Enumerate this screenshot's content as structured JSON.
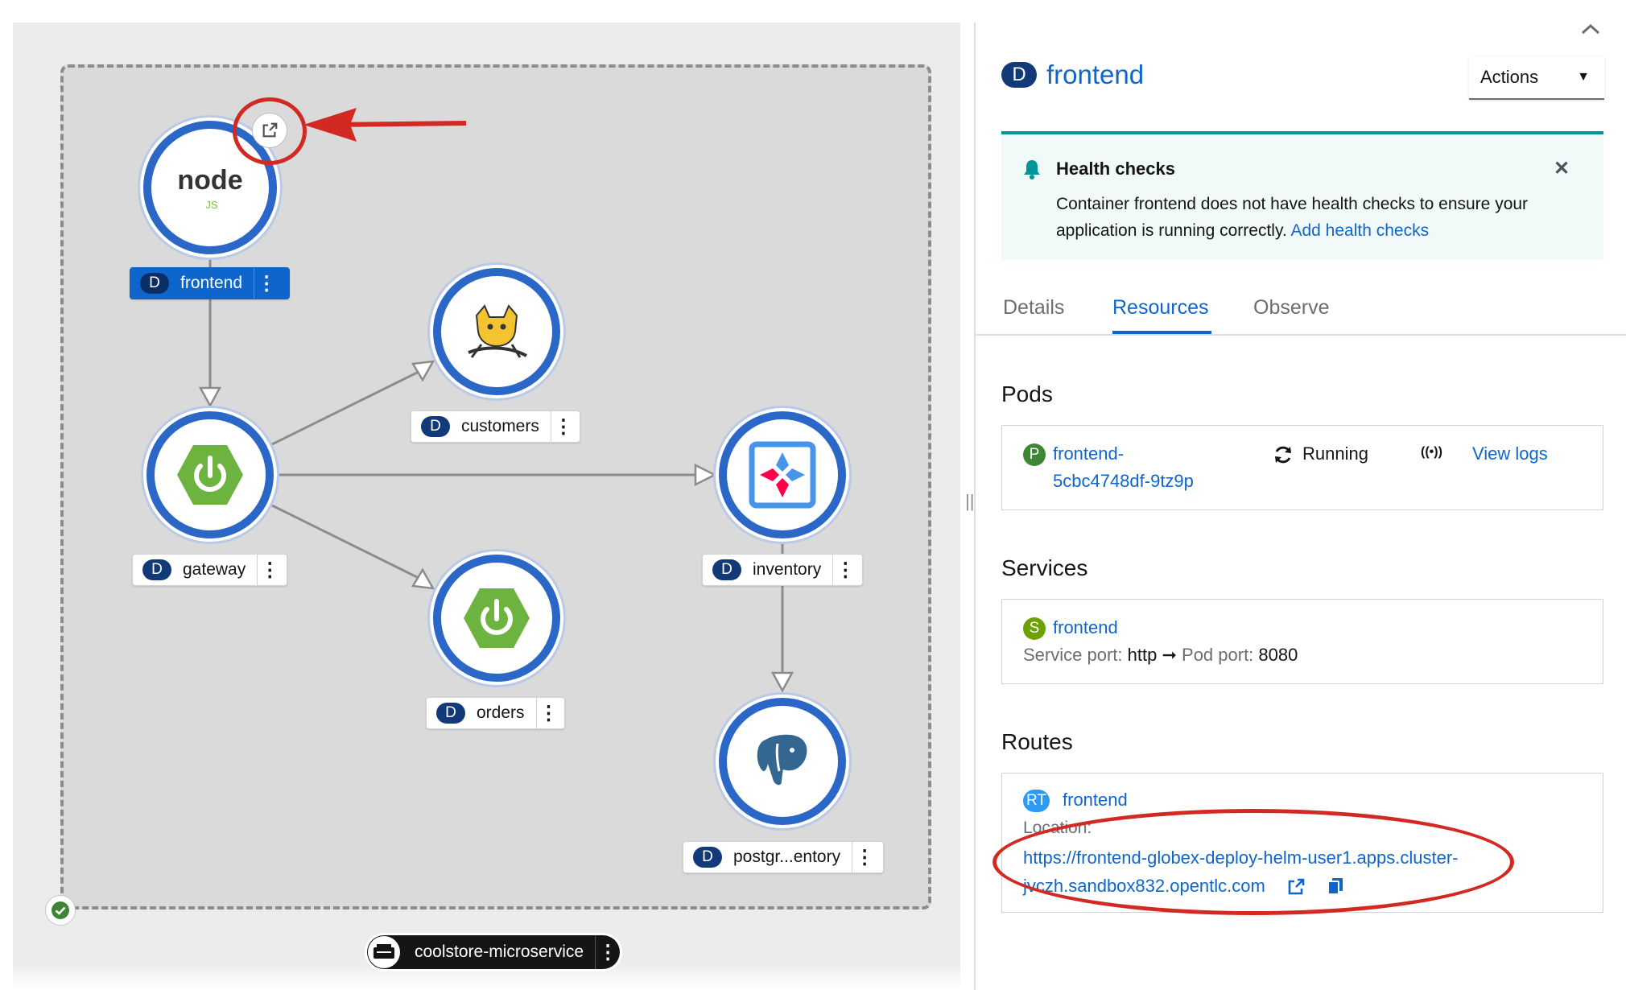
{
  "colors": {
    "node_ring": "#2a67c6",
    "badge_dark": "#133a78",
    "selected_label": "#0e66cd",
    "link": "#0e66cd",
    "alert_bg": "#f2f9f9",
    "alert_border": "#009596",
    "spring_green": "#6db33f",
    "pod_green": "#3e8635",
    "route_blue": "#2b9af3",
    "annotation_red": "#d22a23"
  },
  "topology": {
    "nodes": [
      {
        "badge": "D",
        "name": "frontend",
        "icon": "nodejs-icon"
      },
      {
        "badge": "D",
        "name": "customers",
        "icon": "tomcat-icon"
      },
      {
        "badge": "D",
        "name": "gateway",
        "icon": "spring-boot-icon"
      },
      {
        "badge": "D",
        "name": "inventory",
        "icon": "quarkus-icon"
      },
      {
        "badge": "D",
        "name": "orders",
        "icon": "spring-boot-icon"
      },
      {
        "badge": "D",
        "name": "postgr...entory",
        "icon": "postgresql-icon"
      }
    ],
    "application": {
      "name": "coolstore-microservice"
    },
    "nodejs_logo_text": "node",
    "nodejs_logo_sub": "JS"
  },
  "panel": {
    "title_badge": "D",
    "title": "frontend",
    "actions_label": "Actions",
    "alert": {
      "title": "Health checks",
      "body": "Container frontend does not have health checks to ensure your application is running correctly.",
      "link": "Add health checks"
    },
    "tabs": [
      "Details",
      "Resources",
      "Observe"
    ],
    "pods": {
      "heading": "Pods",
      "badge": "P",
      "name_line1": "frontend-",
      "name_line2": "5cbc4748df-9tz9p",
      "status": "Running",
      "logs_link": "View logs"
    },
    "services": {
      "heading": "Services",
      "badge": "S",
      "name": "frontend",
      "port_label": "Service port:",
      "port_value": "http",
      "arrow": "➞",
      "pod_port_label": "Pod port:",
      "pod_port_value": "8080"
    },
    "routes": {
      "heading": "Routes",
      "badge": "RT",
      "name": "frontend",
      "location_label": "Location:",
      "url_line1": "https://frontend-globex-deploy-helm-user1.apps.cluster-",
      "url_line2": "jvczh.sandbox832.opentlc.com"
    }
  }
}
